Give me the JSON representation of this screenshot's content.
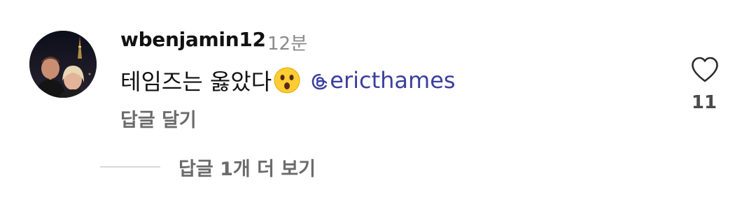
{
  "comment": {
    "username": "wbenjamin12",
    "timestamp": "12분",
    "text": "테임즈는 옳았다",
    "emoji": "astonished-face-emoji",
    "mention": "ericthames",
    "reply_label": "답글 달기",
    "like_count": "11"
  },
  "replies": {
    "view_more_label": "답글 1개 더 보기"
  },
  "colors": {
    "mention": "#3b3f9e",
    "secondary_text": "#6b6b6b",
    "timestamp": "#8a8a8a",
    "divider": "#d9d9d9"
  },
  "icons": {
    "avatar": "avatar",
    "like": "heart-outline-icon",
    "mention": "threads-at-icon"
  }
}
